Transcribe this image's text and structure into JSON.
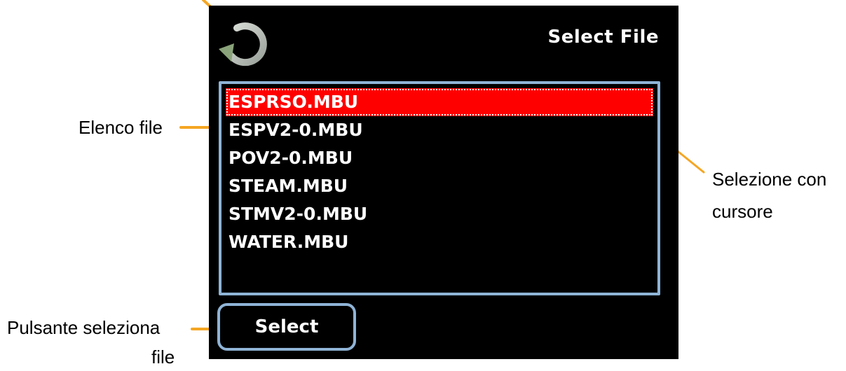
{
  "screen": {
    "title": "Select File",
    "back_icon": "refresh-back-icon",
    "files": [
      "ESPRSO.MBU",
      "ESPV2-0.MBU",
      "POV2-0.MBU",
      "STEAM.MBU",
      "STMV2-0.MBU",
      "WATER.MBU"
    ],
    "selected_index": 0,
    "select_button_label": "Select"
  },
  "callouts": {
    "file_list": "Elenco file",
    "cursor_line1": "Selezione con",
    "cursor_line2": "cursore",
    "select_line1": "Pulsante seleziona",
    "select_line2": "file"
  },
  "colors": {
    "screen_bg": "#000000",
    "selection": "#ff0000",
    "border": "#8fb4d6",
    "callout_line": "#f5a623"
  }
}
